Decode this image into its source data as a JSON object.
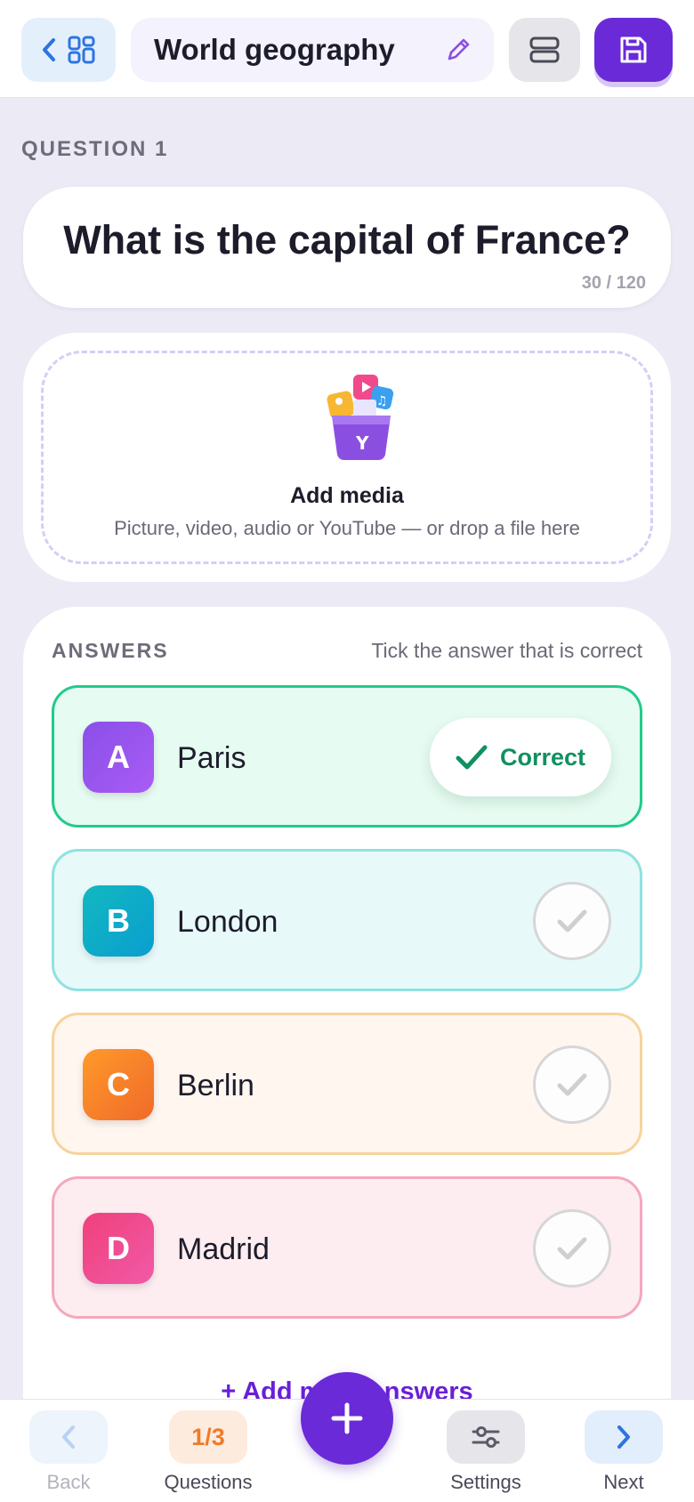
{
  "header": {
    "title": "World geography",
    "icons": [
      "chevron-left-icon",
      "grid-icon",
      "pencil-icon",
      "layout-icon",
      "save-icon"
    ]
  },
  "question": {
    "label": "QUESTION 1",
    "text": "What is the capital of France?",
    "char_count": "30 / 120"
  },
  "media": {
    "title": "Add media",
    "subtitle": "Picture, video, audio or YouTube — or drop a file here"
  },
  "answers": {
    "heading": "ANSWERS",
    "hint": "Tick the answer that is correct",
    "correct_label": "Correct",
    "items": [
      {
        "letter": "A",
        "text": "Paris",
        "correct": true
      },
      {
        "letter": "B",
        "text": "London",
        "correct": false
      },
      {
        "letter": "C",
        "text": "Berlin",
        "correct": false
      },
      {
        "letter": "D",
        "text": "Madrid",
        "correct": false
      }
    ],
    "add_more": "+ Add more answers"
  },
  "nav": {
    "back": "Back",
    "questions_count": "1/3",
    "questions": "Questions",
    "settings": "Settings",
    "next": "Next"
  },
  "colors": {
    "primary": "#6a2ad8",
    "correct": "#119060"
  }
}
